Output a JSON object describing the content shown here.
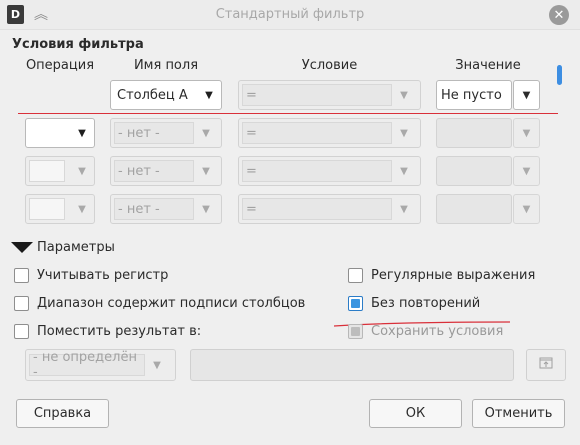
{
  "window": {
    "title": "Стандартный фильтр",
    "app_icon": "D",
    "close_glyph": "✕",
    "collapse_glyph": "︽"
  },
  "conditions": {
    "title": "Условия фильтра",
    "headers": {
      "operation": "Операция",
      "field": "Имя поля",
      "condition": "Условие",
      "value": "Значение"
    },
    "rows": [
      {
        "operation": "",
        "field": "Столбец A",
        "condition": "=",
        "value": "Не пусто",
        "enabled": true
      },
      {
        "operation": "",
        "field": "- нет -",
        "condition": "=",
        "value": "",
        "enabled": false
      },
      {
        "operation": "",
        "field": "- нет -",
        "condition": "=",
        "value": "",
        "enabled": false
      },
      {
        "operation": "",
        "field": "- нет -",
        "condition": "=",
        "value": "",
        "enabled": false
      }
    ]
  },
  "parameters": {
    "title": "Параметры",
    "case_sensitive": {
      "label": "Учитывать регистр",
      "checked": false
    },
    "regex": {
      "label": "Регулярные выражения",
      "checked": false
    },
    "has_headers": {
      "label": "Диапазон содержит подписи столбцов",
      "checked": false
    },
    "no_duplicates": {
      "label": "Без повторений",
      "checked": true
    },
    "copy_results": {
      "label": "Поместить результат в:",
      "checked": false
    },
    "keep_conditions": {
      "label": "Сохранить условия",
      "checked": true,
      "disabled": true
    },
    "target_select": "- не определён -",
    "target_input": ""
  },
  "buttons": {
    "help": "Справка",
    "ok": "ОК",
    "cancel": "Отменить"
  },
  "colors": {
    "accent": "#3b95e0",
    "annotation_red": "#d9303a"
  }
}
